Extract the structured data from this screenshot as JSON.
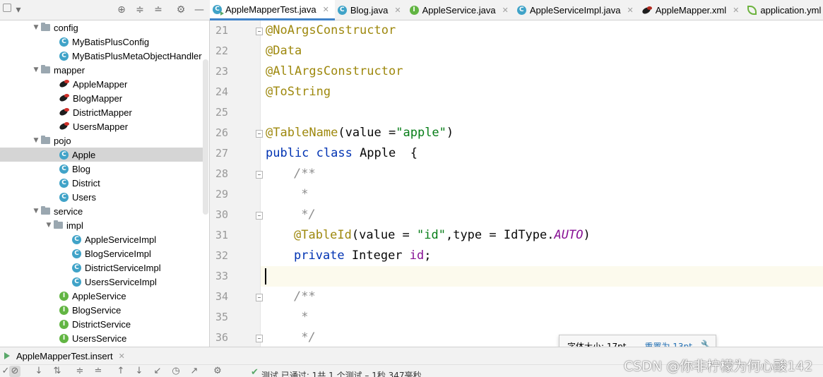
{
  "project_toolbar": {
    "icons": [
      "dropdown-icon",
      "target-icon",
      "collapse-all-icon",
      "expand-all-icon",
      "gear-icon",
      "hide-icon"
    ]
  },
  "tabs": [
    {
      "label": "AppleMapperTest.java",
      "icon": "test-class-icon",
      "active": true
    },
    {
      "label": "Blog.java",
      "icon": "class-icon",
      "active": false
    },
    {
      "label": "AppleService.java",
      "icon": "interface-icon",
      "active": false
    },
    {
      "label": "AppleServiceImpl.java",
      "icon": "class-icon",
      "active": false
    },
    {
      "label": "AppleMapper.xml",
      "icon": "mybatis-xml-icon",
      "active": false
    },
    {
      "label": "application.yml",
      "icon": "spring-leaf-icon",
      "active": false
    }
  ],
  "tree": {
    "config": "config",
    "MyBatisPlusConfig": "MyBatisPlusConfig",
    "MyBatisPlusMetaObjectHandler": "MyBatisPlusMetaObjectHandler",
    "mapper": "mapper",
    "AppleMapper": "AppleMapper",
    "BlogMapper": "BlogMapper",
    "DistrictMapper": "DistrictMapper",
    "UsersMapper": "UsersMapper",
    "pojo": "pojo",
    "Apple": "Apple",
    "Blog": "Blog",
    "District": "District",
    "Users": "Users",
    "service": "service",
    "impl": "impl",
    "AppleServiceImpl": "AppleServiceImpl",
    "BlogServiceImpl": "BlogServiceImpl",
    "DistrictServiceImpl": "DistrictServiceImpl",
    "UsersServiceImpl": "UsersServiceImpl",
    "AppleService": "AppleService",
    "BlogService": "BlogService",
    "DistrictService": "DistrictService",
    "UsersService": "UsersService",
    "selected": "Apple"
  },
  "editor": {
    "line_numbers": [
      "21",
      "22",
      "23",
      "24",
      "25",
      "26",
      "27",
      "28",
      "29",
      "30",
      "31",
      "32",
      "33",
      "34",
      "35",
      "36"
    ],
    "current_line": "33",
    "code": {
      "l21": "@NoArgsConstructor",
      "l22": "@Data",
      "l23": "@AllArgsConstructor",
      "l24": "@ToString",
      "l26_ann": "@TableName",
      "l26_a": "(value =",
      "l26_str": "\"apple\"",
      "l26_b": ")",
      "l27_kw": "public class",
      "l27_rest": " Apple  {",
      "l28": "/**",
      "l29": " *",
      "l30": " */",
      "l31_ann": "@TableId",
      "l31_a": "(value = ",
      "l31_str": "\"id\"",
      "l31_b": ",type = IdType.",
      "l31_cst": "AUTO",
      "l31_c": ")",
      "l32_kw": "private",
      "l32_type": " Integer ",
      "l32_fld": "id",
      "l32_end": ";",
      "l34": "/**",
      "l35": " *",
      "l36": " */"
    }
  },
  "font_tooltip": {
    "label": "字体大小: 17pt",
    "reset_link": "重置为 13pt"
  },
  "run_panel": {
    "tab_label": "AppleMapperTest.insert",
    "status": "测试 已通过: 1共 1 个测试 – 1秒 347毫秒"
  },
  "watermark": "CSDN @你非柠檬为何心酸142",
  "colors": {
    "annotation": "#9e880d",
    "keyword": "#0033b3",
    "string": "#067d17",
    "doc_comment": "#8c8c8c",
    "field": "#871094",
    "selection": "#d5d5d5",
    "current_line": "#fcfaed",
    "link": "#2470b3"
  }
}
